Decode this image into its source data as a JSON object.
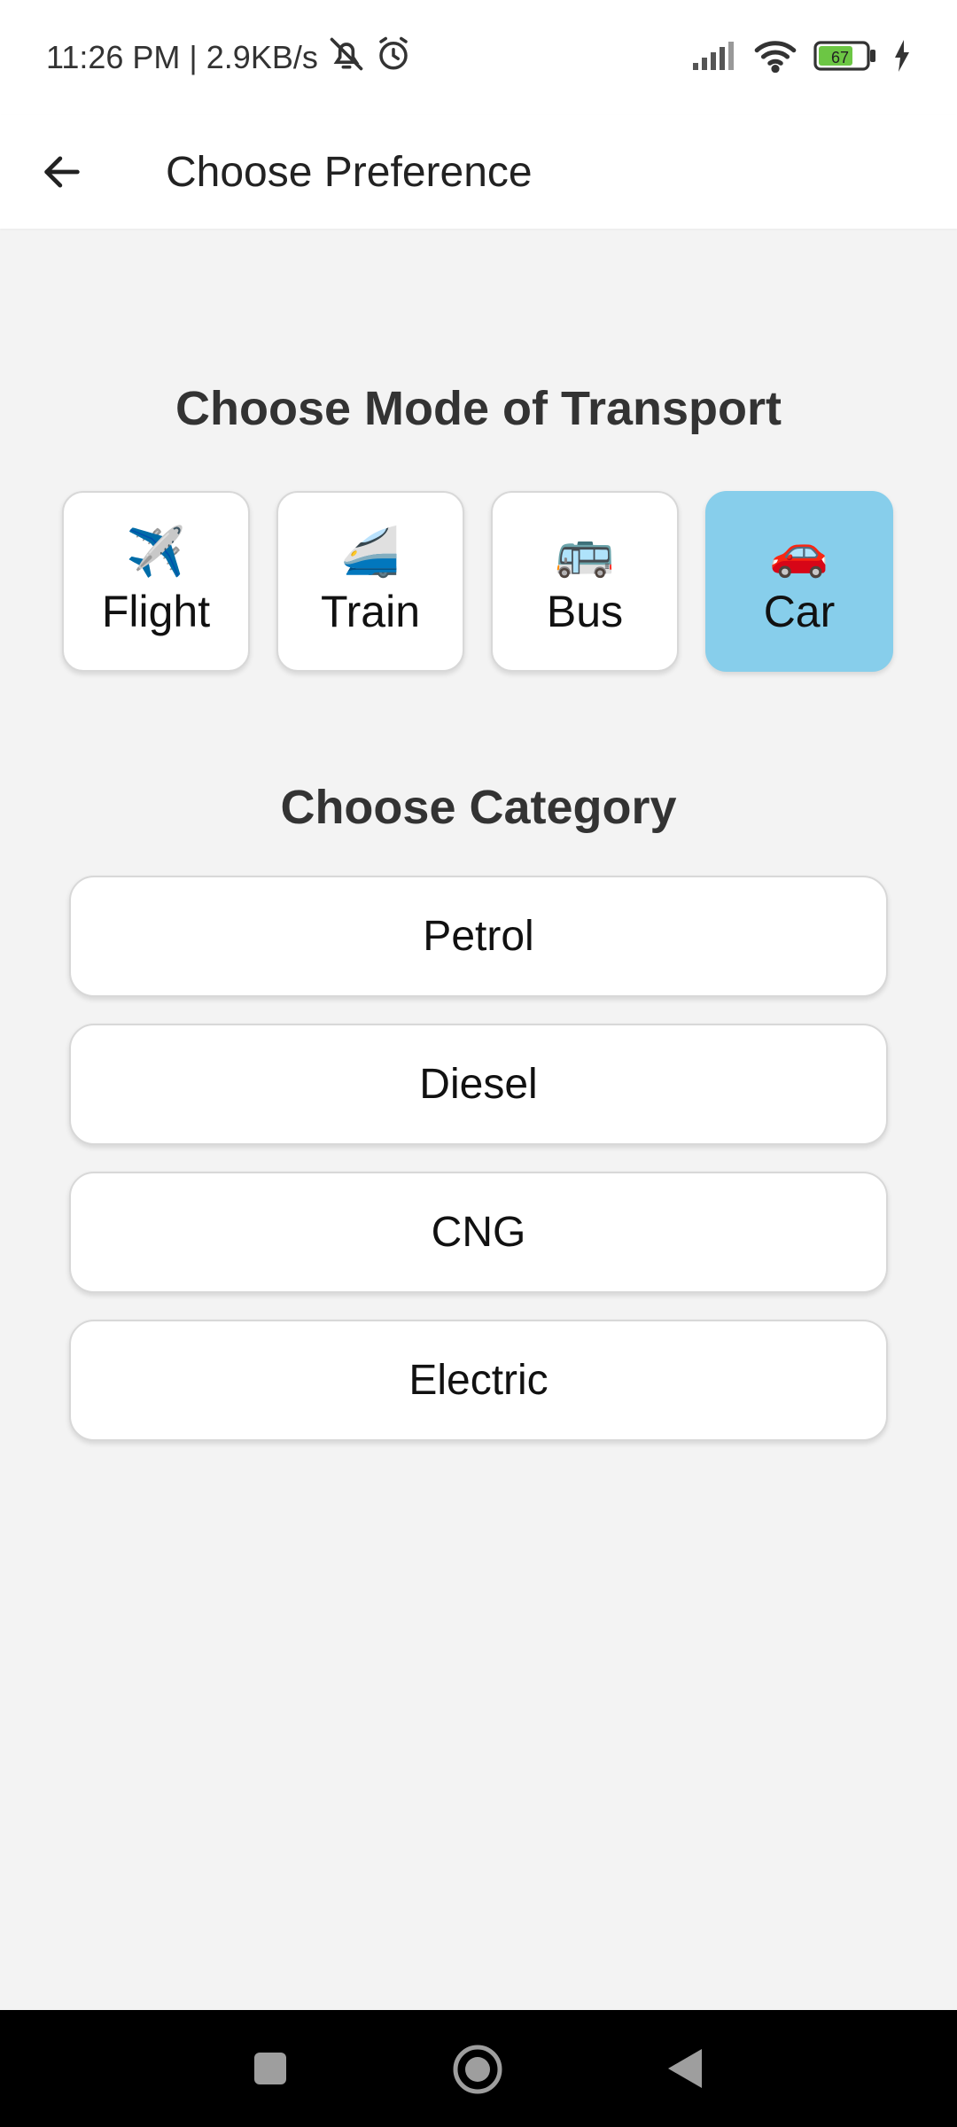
{
  "status_bar": {
    "time_speed": "11:26 PM | 2.9KB/s",
    "battery_level": "67",
    "icons": [
      "mute-icon",
      "alarm-icon",
      "signal-icon",
      "wifi-icon",
      "battery-icon",
      "charging-icon"
    ]
  },
  "app_bar": {
    "title": "Choose Preference",
    "back_icon": "arrow-left-icon"
  },
  "transport": {
    "title": "Choose Mode of Transport",
    "selected": "Car",
    "selected_color": "#87ceeb",
    "modes": [
      {
        "label": "Flight",
        "icon": "✈️"
      },
      {
        "label": "Train",
        "icon": "🚄"
      },
      {
        "label": "Bus",
        "icon": "🚌"
      },
      {
        "label": "Car",
        "icon": "🚗"
      }
    ]
  },
  "category": {
    "title": "Choose Category",
    "items": [
      "Petrol",
      "Diesel",
      "CNG",
      "Electric"
    ]
  },
  "nav_bar": {
    "icons": [
      "recents-square-icon",
      "home-circle-icon",
      "back-triangle-icon"
    ]
  }
}
